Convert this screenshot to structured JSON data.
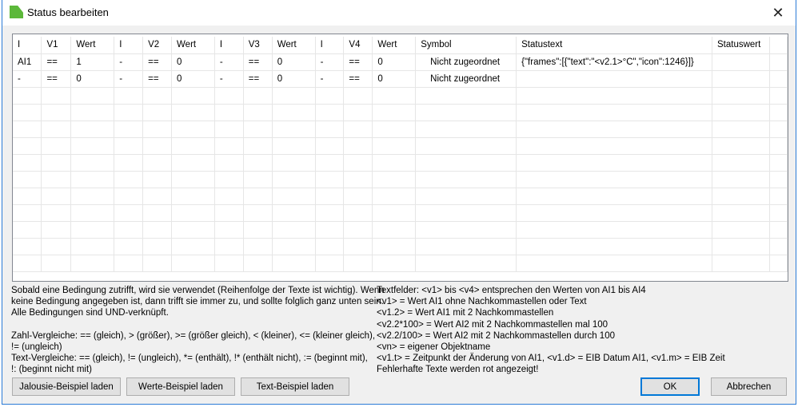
{
  "window": {
    "title": "Status bearbeiten"
  },
  "table": {
    "headers": [
      "I",
      "V1",
      "Wert",
      "I",
      "V2",
      "Wert",
      "I",
      "V3",
      "Wert",
      "I",
      "V4",
      "Wert",
      "Symbol",
      "Statustext",
      "Statuswert",
      ""
    ],
    "rows": [
      [
        "AI1",
        "==",
        "1",
        "-",
        "==",
        "0",
        "-",
        "==",
        "0",
        "-",
        "==",
        "0",
        "Nicht zugeordnet",
        "{\"frames\":[{\"text\":\"<v2.1>°C\",\"icon\":1246}]}",
        "",
        ""
      ],
      [
        "-",
        "==",
        "0",
        "-",
        "==",
        "0",
        "-",
        "==",
        "0",
        "-",
        "==",
        "0",
        "Nicht zugeordnet",
        "",
        "",
        ""
      ]
    ],
    "empty_rows": 11
  },
  "help_left": [
    "Sobald eine Bedingung zutrifft, wird sie verwendet (Reihenfolge der Texte ist wichtig). Wenn",
    "keine Bedingung angegeben ist, dann trifft sie immer zu, und sollte folglich ganz unten sein.",
    "Alle Bedingungen sind UND-verknüpft.",
    "",
    "Zahl-Vergleiche: == (gleich), > (größer), >= (größer gleich), < (kleiner), <= (kleiner gleich),",
    "!= (ungleich)",
    "Text-Vergleiche: == (gleich), != (ungleich), *= (enthält), !* (enthält nicht), := (beginnt mit),",
    "!: (beginnt nicht mit)"
  ],
  "help_right": [
    "Textfelder: <v1> bis <v4> entsprechen den Werten von AI1 bis AI4",
    "<v1> = Wert AI1 ohne Nachkommastellen oder Text",
    "<v1.2> = Wert AI1 mit 2 Nachkommastellen",
    "<v2.2*100> = Wert AI2 mit 2 Nachkommastellen mal 100",
    "<v2.2/100> = Wert AI2 mit 2 Nachkommastellen durch 100",
    "<vn> = eigener Objektname",
    "<v1.t> = Zeitpunkt der Änderung von AI1, <v1.d> = EIB Datum AI1, <v1.m> = EIB Zeit",
    "Fehlerhafte Texte werden rot angezeigt!"
  ],
  "buttons": {
    "jalousie": "Jalousie-Beispiel laden",
    "werte": "Werte-Beispiel laden",
    "text": "Text-Beispiel laden",
    "ok": "OK",
    "cancel": "Abbrechen"
  }
}
